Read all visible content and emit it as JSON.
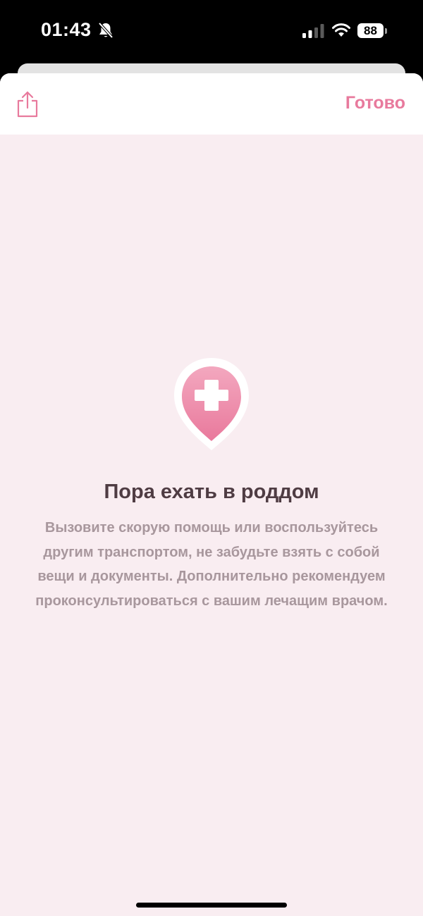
{
  "status_bar": {
    "time": "01:43",
    "battery_level": "88",
    "icons": [
      "bell-muted-icon",
      "cellular-signal-icon",
      "wifi-icon",
      "battery-icon"
    ]
  },
  "header": {
    "share_icon": "share-icon",
    "done_label": "Готово"
  },
  "content": {
    "icon": "hospital-location-pin-icon",
    "title": "Пора ехать в роддом",
    "description": "Вызовите скорую помощь или воспользуйтесь другим транспортом, не забудьте взять с собой вещи и документы. Дополнительно рекомендуем проконсультироваться с вашим лечащим врачом."
  },
  "colors": {
    "accent": "#e87a9d",
    "background": "#f9edf1",
    "title": "#4f3c43",
    "description": "#a8979d"
  }
}
